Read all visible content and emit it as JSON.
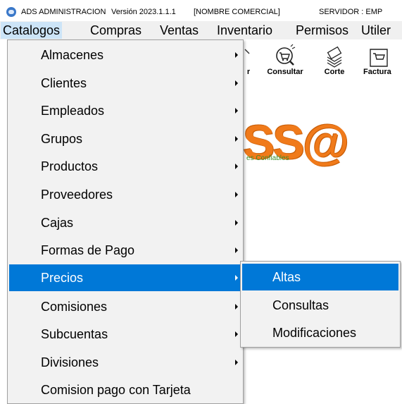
{
  "titlebar": {
    "app_name": "ADS ADMINISTRACION",
    "version": "Versión 2023.1.1.1",
    "company": "[NOMBRE COMERCIAL]",
    "server": "SERVIDOR : EMP"
  },
  "menubar": {
    "items": [
      {
        "label": "Catalogos",
        "active": true
      },
      {
        "label": "Compras"
      },
      {
        "label": "Ventas"
      },
      {
        "label": "Inventario"
      },
      {
        "label": "Permisos"
      },
      {
        "label": "Utiler"
      }
    ]
  },
  "toolbar": {
    "items": [
      {
        "label": "r",
        "icon": "partial-icon"
      },
      {
        "label": "Consultar",
        "icon": "cart-search-icon"
      },
      {
        "label": "Corte",
        "icon": "money-stack-icon"
      },
      {
        "label": "Factura",
        "icon": "invoice-cart-icon"
      }
    ]
  },
  "logo": {
    "text": "SS@",
    "tagline": "es Confiables",
    "color": "#f07a1a"
  },
  "dropdown": {
    "items": [
      {
        "label": "Almacenes",
        "submenu": true
      },
      {
        "label": "Clientes",
        "submenu": true
      },
      {
        "label": "Empleados",
        "submenu": true
      },
      {
        "label": "Grupos",
        "submenu": true
      },
      {
        "label": "Productos",
        "submenu": true
      },
      {
        "label": "Proveedores",
        "submenu": true
      },
      {
        "label": "Cajas",
        "submenu": true
      },
      {
        "label": "Formas de Pago",
        "submenu": true
      },
      {
        "label": "Precios",
        "submenu": true,
        "selected": true
      },
      {
        "label": "Comisiones",
        "submenu": true
      },
      {
        "label": "Subcuentas",
        "submenu": true
      },
      {
        "label": "Divisiones",
        "submenu": true
      },
      {
        "label": "Comision pago con Tarjeta",
        "submenu": false
      }
    ]
  },
  "submenu": {
    "items": [
      {
        "label": "Altas",
        "selected": true
      },
      {
        "label": "Consultas"
      },
      {
        "label": "Modificaciones"
      }
    ]
  },
  "colors": {
    "selection": "#0078d7",
    "menu_background": "#f2f2f2",
    "menubar_active": "#cce4f7"
  }
}
